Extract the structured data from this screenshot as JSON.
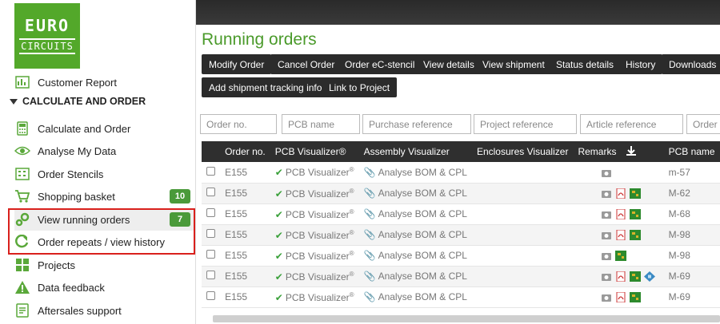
{
  "logo": {
    "line1": "EURO",
    "line2": "CIRCUITS"
  },
  "sidebar": {
    "customer_report": "Customer Report",
    "section": "CALCULATE AND ORDER",
    "items": [
      {
        "label": "Calculate and Order",
        "icon": "calculator-icon"
      },
      {
        "label": "Analyse My Data",
        "icon": "eye-icon"
      },
      {
        "label": "Order Stencils",
        "icon": "stencil-icon"
      },
      {
        "label": "Shopping basket",
        "icon": "cart-icon",
        "badge": "10"
      },
      {
        "label": "View running orders",
        "icon": "gears-icon",
        "badge": "7"
      },
      {
        "label": "Order repeats / view history",
        "icon": "refresh-icon"
      },
      {
        "label": "Projects",
        "icon": "projects-icon"
      },
      {
        "label": "Data feedback",
        "icon": "warning-icon"
      },
      {
        "label": "Aftersales support",
        "icon": "support-icon"
      }
    ]
  },
  "main": {
    "title": "Running orders",
    "buttons": {
      "modify": "Modify Order",
      "cancel": "Cancel Order",
      "stencil": "Order eC-stencil",
      "details": "View details",
      "shipment": "View shipment",
      "status": "Status details",
      "history": "History",
      "downloads": "Downloads",
      "tracking": "Add shipment tracking info",
      "link_project": "Link to Project"
    },
    "filters": {
      "order_no": "Order no.",
      "pcb_name": "PCB name",
      "purchase_ref": "Purchase reference",
      "project_ref": "Project reference",
      "article_ref": "Article reference",
      "order_t": "Order t"
    }
  },
  "table": {
    "headers": {
      "order_no": "Order no.",
      "pcb_vis": "PCB Visualizer®",
      "asm_vis": "Assembly Visualizer",
      "enc_vis": "Enclosures Visualizer",
      "remarks": "Remarks",
      "pcb_name": "PCB name"
    },
    "pcb_vis_text": "PCB Visualizer",
    "pcb_vis_sup": "®",
    "asm_text": "Analyse BOM & CPL",
    "rows": [
      {
        "order": "E155",
        "pcb": "m-57"
      },
      {
        "order": "E155",
        "pcb": "M-62"
      },
      {
        "order": "E155",
        "pcb": "M-68"
      },
      {
        "order": "E155",
        "pcb": "M-98"
      },
      {
        "order": "E155",
        "pcb": "M-98"
      },
      {
        "order": "E155",
        "pcb": "M-69"
      },
      {
        "order": "E155",
        "pcb": "M-69"
      }
    ]
  },
  "colors": {
    "brand_green": "#53a82a",
    "title_green": "#4a9a2a",
    "highlight_red": "#d9201c",
    "toolbar_dark": "#2b2b2b"
  }
}
